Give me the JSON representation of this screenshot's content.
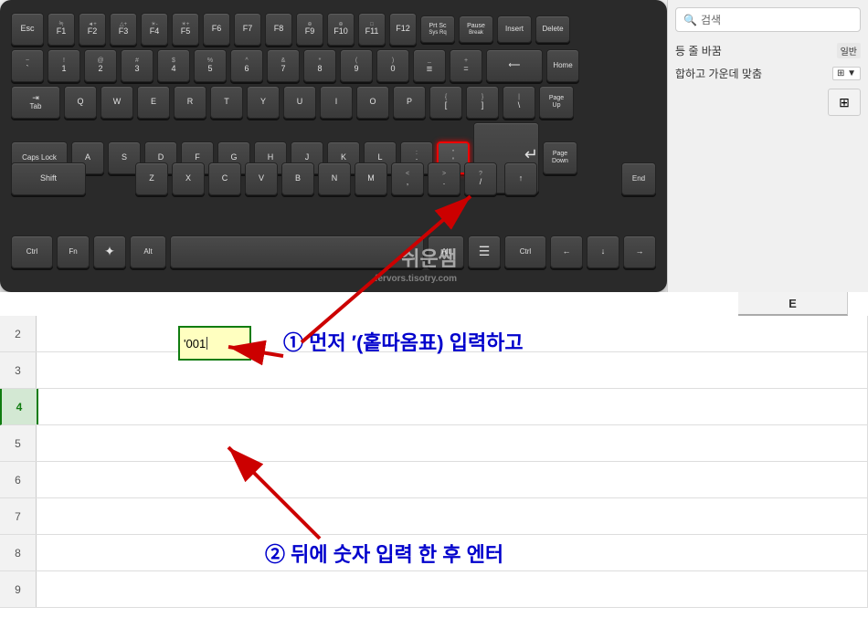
{
  "keyboard": {
    "rows": [
      {
        "keys": [
          {
            "label": "Esc",
            "wide": "normal"
          },
          {
            "label": "F1",
            "sub": "녹",
            "wide": "fn"
          },
          {
            "label": "F2",
            "sub": "◄+",
            "wide": "fn"
          },
          {
            "label": "F3",
            "sub": "△+",
            "wide": "fn"
          },
          {
            "label": "F4",
            "sub": "☀-",
            "wide": "fn"
          },
          {
            "label": "F5",
            "sub": "☀+",
            "wide": "fn"
          },
          {
            "label": "F6",
            "wide": "fn"
          },
          {
            "label": "F7",
            "wide": "fn"
          },
          {
            "label": "F8",
            "wide": "fn"
          },
          {
            "label": "F9",
            "sub": "⊕",
            "wide": "fn"
          },
          {
            "label": "F10",
            "sub": "⊕",
            "wide": "fn"
          },
          {
            "label": "F11",
            "sub": "□",
            "wide": "fn"
          },
          {
            "label": "F12",
            "wide": "fn"
          },
          {
            "label": "Prt Sc\nSys Rq",
            "wide": "small"
          },
          {
            "label": "Pause\nBreak",
            "wide": "small"
          },
          {
            "label": "Insert",
            "wide": "small"
          },
          {
            "label": "Delete",
            "wide": "small"
          }
        ]
      }
    ],
    "highlighted_key": "apostrophe",
    "caps_lock_label": "Caps Lock"
  },
  "right_panel": {
    "search_placeholder": "검색",
    "option1": "등 줄 바꿈",
    "option2": "합하고 가운데 맞춤",
    "col_header": "E"
  },
  "spreadsheet": {
    "rows": [
      {
        "num": "2",
        "active": false
      },
      {
        "num": "3",
        "active": false
      },
      {
        "num": "4",
        "active": true,
        "cell_value": "'001"
      },
      {
        "num": "5",
        "active": false
      },
      {
        "num": "6",
        "active": false
      },
      {
        "num": "7",
        "active": false
      },
      {
        "num": "8",
        "active": false
      },
      {
        "num": "9",
        "active": false
      }
    ],
    "col_header": "E"
  },
  "annotations": {
    "step1": "① 먼저 ′(홑따옴표) 입력하고",
    "step2": "② 뒤에 숫자 입력 한 후 엔터"
  },
  "watermark": {
    "line1": "쉬운쌤",
    "line2": "fervors.tisotry.com"
  }
}
